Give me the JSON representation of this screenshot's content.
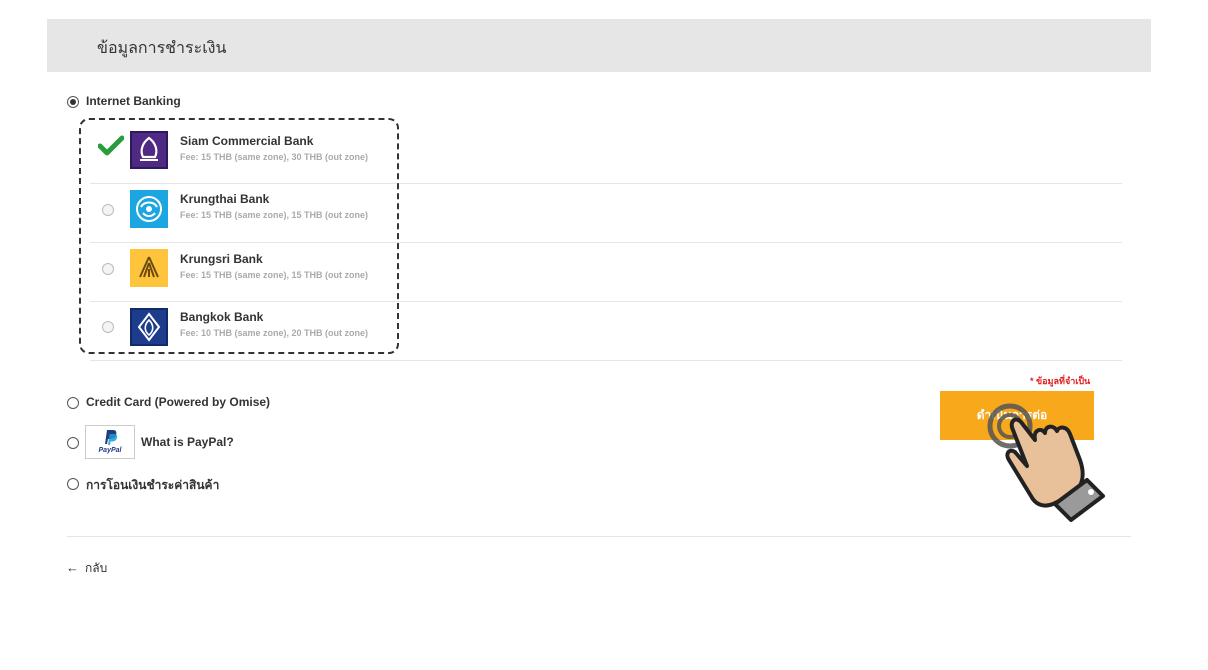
{
  "header": {
    "title": "ข้อมูลการชำระเงิน"
  },
  "payment_methods": {
    "internet_banking": "Internet Banking",
    "credit_card": "Credit Card (Powered by Omise)",
    "paypal": "What is PayPal?",
    "paypal_logo_text": "PayPal",
    "bank_transfer": "การโอนเงินชำระค่าสินค้า"
  },
  "banks": [
    {
      "name": "Siam Commercial Bank",
      "fee": "Fee: 15 THB (same zone), 30 THB (out zone)",
      "color": "#4e2a84",
      "selected": true
    },
    {
      "name": "Krungthai Bank",
      "fee": "Fee: 15 THB (same zone), 15 THB (out zone)",
      "color": "#1ba5e1",
      "selected": false
    },
    {
      "name": "Krungsri Bank",
      "fee": "Fee: 15 THB (same zone), 15 THB (out zone)",
      "color": "#fec43b",
      "selected": false
    },
    {
      "name": "Bangkok Bank",
      "fee": "Fee: 10 THB (same zone), 20 THB (out zone)",
      "color": "#1e3c8c",
      "selected": false
    }
  ],
  "form": {
    "required_note": "* ข้อมูลที่จำเป็น",
    "continue_label": "ดำเนินการต่อ"
  },
  "nav": {
    "back_label": "กลับ"
  },
  "colors": {
    "accent": "#f7a81b",
    "check": "#2a9d3a",
    "required": "#e02020"
  }
}
